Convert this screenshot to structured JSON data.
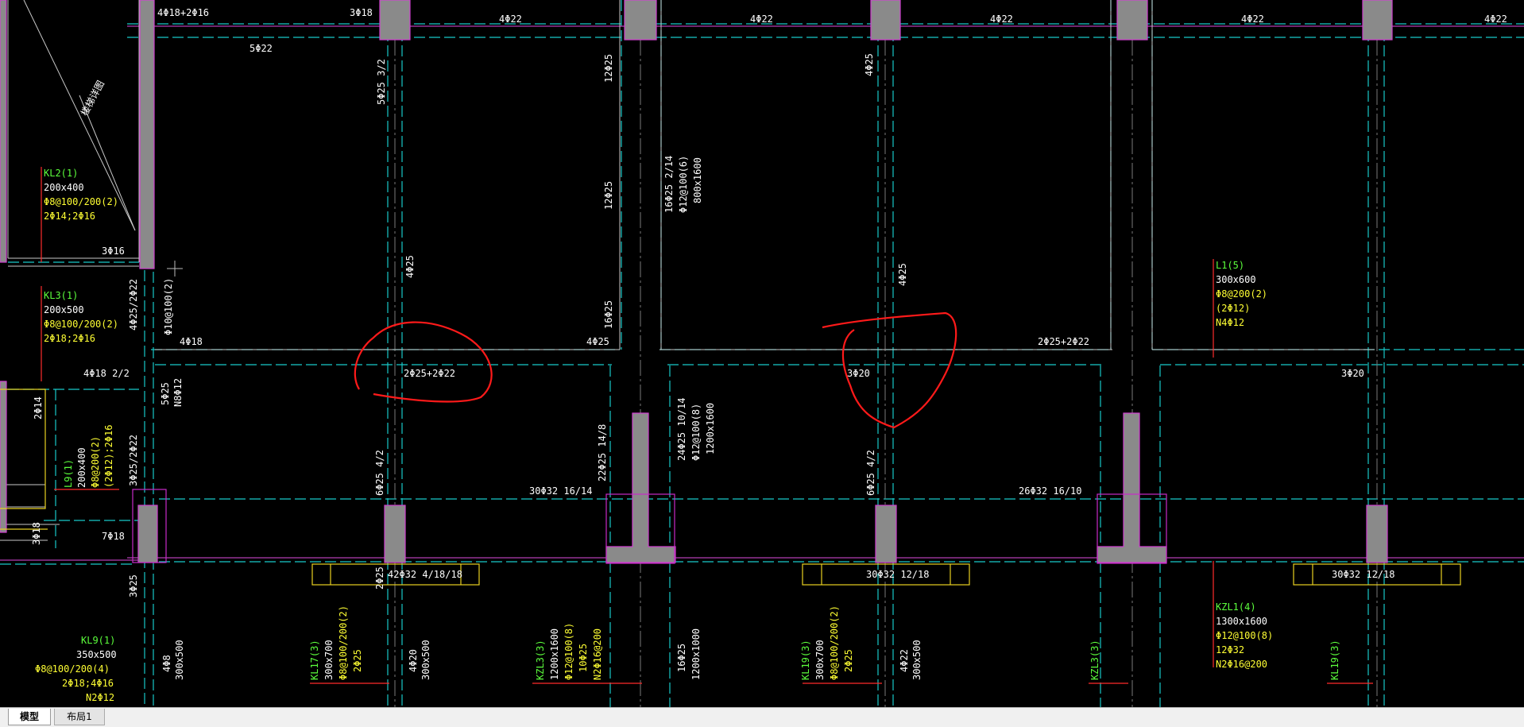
{
  "tabs": [
    {
      "label": "模型",
      "active": true
    },
    {
      "label": "布局1",
      "active": false
    }
  ],
  "colors": {
    "background": "#000000",
    "axis_dashed": "#18c9c9",
    "beam_outline": "#c82ac8",
    "column_fill": "#8a8a8a",
    "markup": "#ff2222",
    "text_white": "#ffffff",
    "text_green": "#5cff3c",
    "text_yellow": "#ffff33"
  },
  "annotations": {
    "top_left_1": "4Φ18+2Φ16",
    "top_3phi18": "3Φ18",
    "top_4phi22": "4Φ22",
    "top_5phi22": "5Φ22",
    "v_5phi25_32": "5Φ25 3/2",
    "v_12phi25": "12Φ25",
    "v_4phi25": "4Φ25",
    "stair_label": "楼梯详图",
    "kl2_name": "KL2(1)",
    "kl2_size": "200x400",
    "kl2_stirrup": "Φ8@100/200(2)",
    "kl2_bars": "2Φ14;2Φ16",
    "kl3_name": "KL3(1)",
    "kl3_size": "200x500",
    "kl3_stirrup": "Φ8@100/200(2)",
    "kl3_bars": "2Φ18;2Φ16",
    "t_3phi16": "3Φ16",
    "v_4phi25_2phi22": "4Φ25/2Φ22",
    "v_phi10": "Φ10@100(2)",
    "t_4phi18": "4Φ18",
    "t_4phi18_22": "4Φ18 2/2",
    "t_4phi25": "4Φ25",
    "t_2phi25_2phi22": "2Φ25+2Φ22",
    "t_3phi20": "3Φ20",
    "v_16phi25": "16Φ25",
    "v_16phi25_214": "16Φ25 2/14",
    "v_phi12_100_6": "Φ12@100(6)",
    "v_800x1600": "800x1600",
    "l1_name": "L1(5)",
    "l1_size": "300x600",
    "l1_stirrup": "Φ8@200(2)",
    "l1_bars": "(2Φ12)",
    "l1_n": "N4Φ12",
    "v_5phi25": "5Φ25",
    "v_n8phi12": "N8Φ12",
    "v_2phi14": "2Φ14",
    "l9_name": "L9(1)",
    "l9_size": "200x400",
    "l9_stirrup": "Φ8@200(2)",
    "l9_bars": "(2Φ12);2Φ16",
    "v_3phi25_2phi22": "3Φ25/2Φ22",
    "v_3phi18": "3Φ18",
    "t_7phi18": "7Φ18",
    "v_6phi25_42": "6Φ25 4/2",
    "v_22phi25_148": "22Φ25 14/8",
    "v_24phi25_1014": "24Φ25 10/14",
    "v_phi12_100_8": "Φ12@100(8)",
    "v_1200x1600": "1200x1600",
    "t_30phi32_1614": "30Φ32 16/14",
    "t_26phi32_1610": "26Φ32 16/10",
    "t_42phi32": "42Φ32 4/18/18",
    "t_30phi32_1218": "30Φ32 12/18",
    "v_3phi25": "3Φ25",
    "v_2phi25": "2Φ25",
    "kl9_name": "KL9(1)",
    "kl9_size": "350x500",
    "kl9_stirrup": "Φ8@100/200(4)",
    "kl9_bars": "2Φ18;4Φ16",
    "kl9_n": "N2Φ12",
    "v_4phi8": "4Φ8",
    "v_300x500": "300x500",
    "v_kl17": "KL17(3)",
    "v_300x700": "300x700",
    "v_phi8_100_200_2": "Φ8@100/200(2)",
    "v_4phi20": "4Φ20",
    "v_kzl3": "KZL3(3)",
    "v_1200x1600b": "1200x1600",
    "v_phi12_100_8b": "Φ12@100(8)",
    "v_10phi25": "10Φ25",
    "v_n2phi16": "N2Φ16@200",
    "v_1200x1000": "1200x1000",
    "v_kl19": "KL19(3)",
    "v_4phi22": "4Φ22",
    "kzl1_name": "KZL1(4)",
    "kzl1_size": "1300x1600",
    "kzl1_stirrup": "Φ12@100(8)",
    "kzl1_bars": "12Φ32",
    "kzl1_n": "N2Φ16@200",
    "v_kl19b": "KL19(3)"
  }
}
